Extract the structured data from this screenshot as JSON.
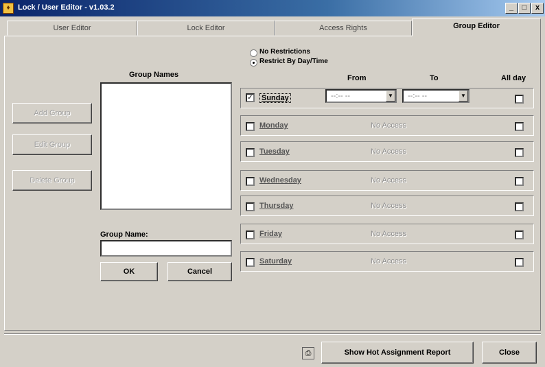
{
  "window": {
    "title": "Lock / User Editor - v1.03.2",
    "buttons": [
      "_",
      "□",
      "x"
    ]
  },
  "tabs": [
    {
      "label": "User Editor",
      "active": false
    },
    {
      "label": "Lock Editor",
      "active": false
    },
    {
      "label": "Access Rights",
      "active": false
    },
    {
      "label": "Group Editor",
      "active": true
    }
  ],
  "left_buttons": {
    "add_group": "Add Group",
    "edit_group": "Edit Group",
    "delete_group": "Delete Group"
  },
  "group_names_label": "Group Names",
  "group_name_label": "Group Name:",
  "group_name_value": "",
  "ok_label": "OK",
  "cancel_label": "Cancel",
  "restriction": {
    "no_restrictions": "No Restrictions",
    "restrict_by": "Restrict By Day/Time",
    "selected": "restrict_by"
  },
  "headers": {
    "from": "From",
    "to": "To",
    "all_day": "All day"
  },
  "days": [
    {
      "name": "Sunday",
      "checked": true,
      "from": "--:-- --",
      "to": "--:-- --",
      "all_day": false
    },
    {
      "name": "Monday",
      "checked": false,
      "status": "No Access",
      "all_day": false
    },
    {
      "name": "Tuesday",
      "checked": false,
      "status": "No Access",
      "all_day": false
    },
    {
      "name": "Wednesday",
      "checked": false,
      "status": "No Access",
      "all_day": false
    },
    {
      "name": "Thursday",
      "checked": false,
      "status": "No Access",
      "all_day": false
    },
    {
      "name": "Friday",
      "checked": false,
      "status": "No Access",
      "all_day": false
    },
    {
      "name": "Saturday",
      "checked": false,
      "status": "No Access",
      "all_day": false
    }
  ],
  "footer": {
    "report_button": "Show Hot Assignment Report",
    "close_button": "Close",
    "print_icon": "printer-icon"
  },
  "colors": {
    "titlebar_start": "#0a246a",
    "titlebar_end": "#a6caf0",
    "face": "#d4d0c8"
  }
}
